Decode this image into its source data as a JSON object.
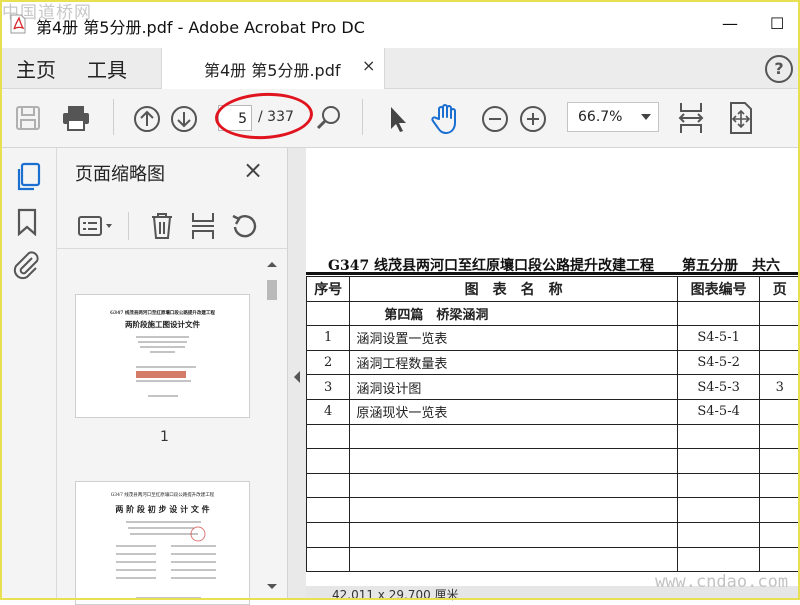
{
  "window": {
    "title": "第4册 第5分册.pdf - Adobe Acrobat Pro DC",
    "minimize": "—",
    "maximize": "☐",
    "watermark": "中国道桥网"
  },
  "nav": {
    "home": "主页",
    "tools": "工具",
    "tab_label": "第4册 第5分册.pdf",
    "tab_close": "×",
    "help": "?"
  },
  "toolbar": {
    "page_current": "5",
    "page_total": "/ 337",
    "zoom": "66.7%",
    "icons": [
      "save-icon",
      "print-icon",
      "prev-page-icon",
      "next-page-icon",
      "search-zoom-icon",
      "select-cursor-icon",
      "hand-tool-icon",
      "zoom-out-icon",
      "zoom-in-icon",
      "fit-width-icon",
      "fit-page-icon"
    ],
    "accent_color": "#1a6fd1",
    "highlight_color": "#e0141e"
  },
  "panel": {
    "title": "页面缩略图",
    "close": "×",
    "thumb1_num": "1",
    "thumb1": {
      "line1": "G347 线茂县两河口至红原壤口段公路提升改建工程",
      "line2": "两阶段施工图设计文件"
    },
    "thumb2": {
      "line1": "G347 线茂县两河口至红原壤口段公路提升改建工程",
      "line2": "两 阶 段 初 步 设 计 文 件"
    }
  },
  "document": {
    "title": "G347 线茂县两河口至红原壤口段公路提升改建工程　　第五分册　共六",
    "headers": [
      "序号",
      "图　表　名　称",
      "图表编号",
      "页"
    ],
    "section": "第四篇　桥梁涵洞",
    "rows": [
      {
        "no": "1",
        "name": "涵洞设置一览表",
        "code": "S4-5-1",
        "page": ""
      },
      {
        "no": "2",
        "name": "涵洞工程数量表",
        "code": "S4-5-2",
        "page": ""
      },
      {
        "no": "3",
        "name": "涵洞设计图",
        "code": "S4-5-3",
        "page": "3"
      },
      {
        "no": "4",
        "name": "原涵现状一览表",
        "code": "S4-5-4",
        "page": ""
      }
    ],
    "status": "42.011 x 29.700 厘米",
    "watermark": "www.cndao.com"
  }
}
